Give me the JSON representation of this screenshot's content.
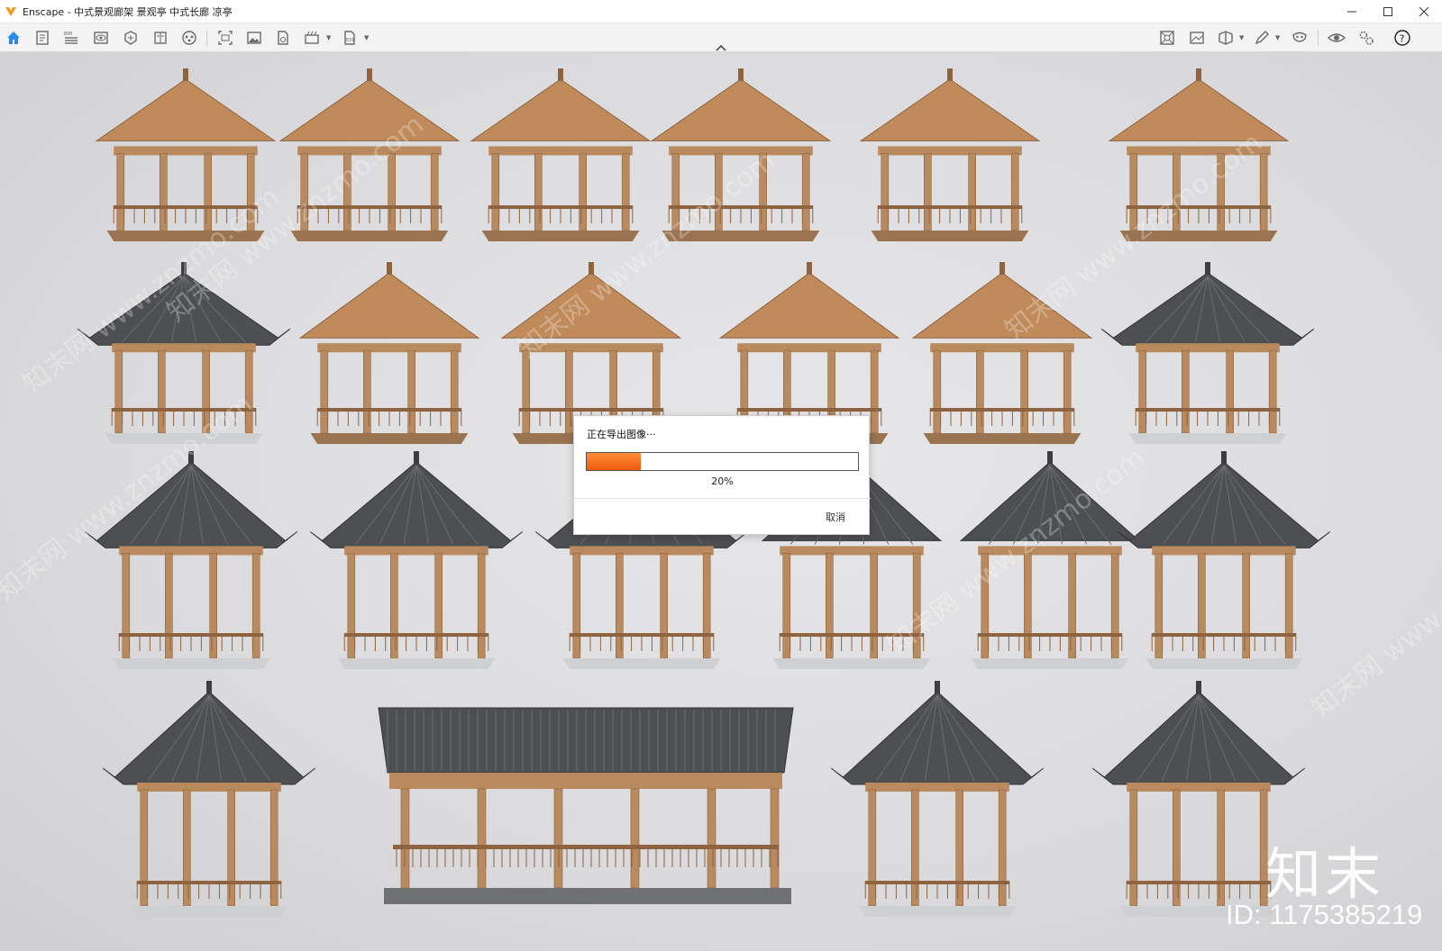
{
  "window": {
    "title": "Enscape - 中式景观廊架 景观亭 中式长廊 凉亭",
    "controls": [
      "minimize-icon",
      "maximize-icon",
      "close-icon"
    ]
  },
  "toolbar": {
    "left_icons": [
      "home-icon",
      "document-icon",
      "bim-icon",
      "eye-view-icon",
      "section-icon",
      "book-icon",
      "asset-library-icon",
      "screenshot-icon",
      "image-icon",
      "file-export-icon",
      "batch-render-icon",
      "export-menu-icon"
    ],
    "right_icons": [
      "capture-icon",
      "render-frame-icon",
      "cube-icon",
      "pen-icon",
      "mask-icon",
      "visibility-icon",
      "settings-icon",
      "help-icon"
    ]
  },
  "dialog": {
    "title": "正在导出图像···",
    "progress_percent": 20,
    "progress_label": "20%",
    "cancel_label": "取消",
    "fill_color": "#f07020"
  },
  "overlay": {
    "brand": "知末",
    "id_label": "ID: 1175385219",
    "watermark_text": "知末网 www.znzmo.com"
  },
  "scene": {
    "description_rows": 4,
    "pavilion_count": 24
  }
}
